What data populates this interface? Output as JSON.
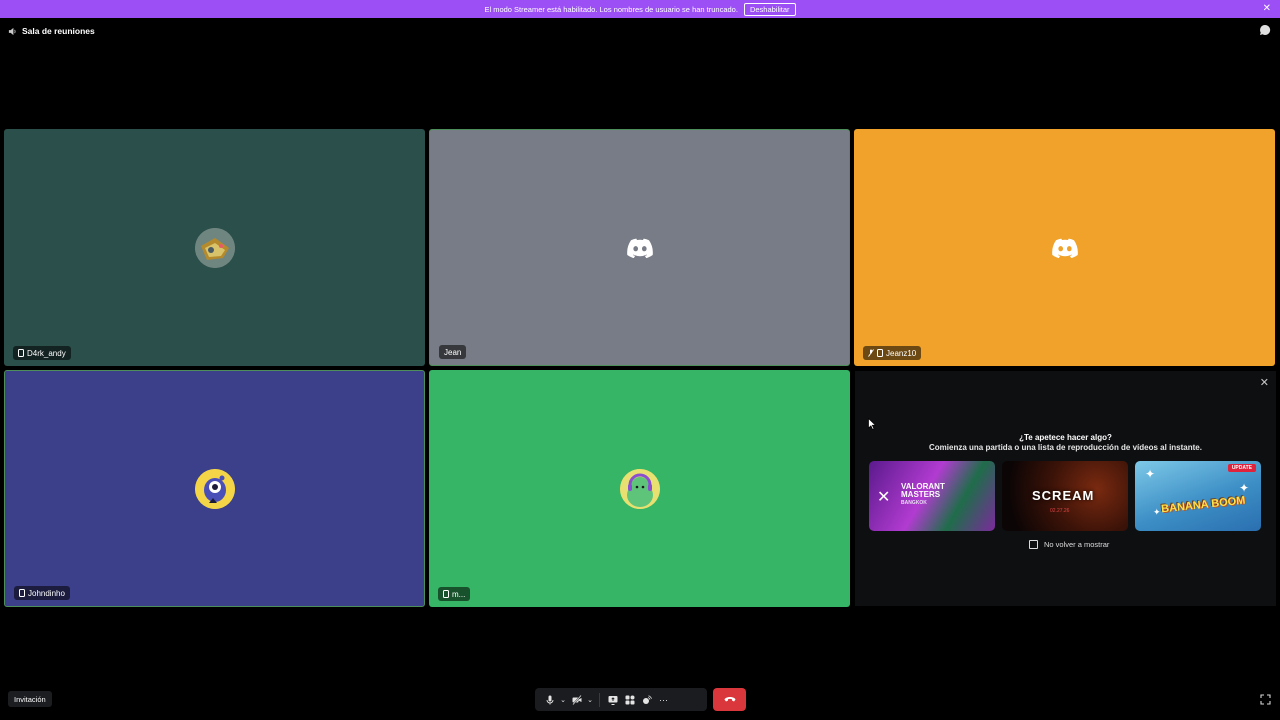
{
  "banner": {
    "text": "El modo Streamer está habilitado. Los nombres de usuario se han truncado.",
    "button_label": "Deshabilitar",
    "close_glyph": "✕",
    "color": "#9b4ff5"
  },
  "channel": {
    "name": "Sala de reuniones",
    "icon": "speaker-icon"
  },
  "tiles": [
    {
      "name": "D4rk_andy",
      "bg": "#2b4f4b",
      "avatar": "custom-avatar",
      "mobile": true
    },
    {
      "name": "Jean",
      "bg": "#787c86",
      "avatar": "discord-logo",
      "mobile": false
    },
    {
      "name": "Jeanz10",
      "bg": "#f0a22a",
      "avatar": "discord-logo",
      "mobile": true,
      "muted": true
    },
    {
      "name": "Johndinho",
      "bg": "#3c3f8a",
      "avatar": "custom-avatar",
      "mobile": true
    },
    {
      "name": "m...",
      "bg": "#35b565",
      "avatar": "custom-avatar",
      "mobile": true
    }
  ],
  "activity": {
    "close_glyph": "✕",
    "title": "¿Te apetece hacer algo?",
    "subtitle": "Comienza una partida o una lista de reproducción de vídeos al instante.",
    "cards": [
      {
        "line1": "VALORANT",
        "line2": "MASTERS",
        "line3": "BANGKOK"
      },
      {
        "label": "SCREAM",
        "date": "02.27.26"
      },
      {
        "label": "BANANA BOOM",
        "badge": "UPDATE"
      }
    ],
    "dont_show": "No volver a mostrar"
  },
  "footer": {
    "invite_label": "Invitación",
    "more_glyph": "···"
  },
  "colors": {
    "hangup": "#da373c",
    "panel": "#1b1c1f"
  }
}
